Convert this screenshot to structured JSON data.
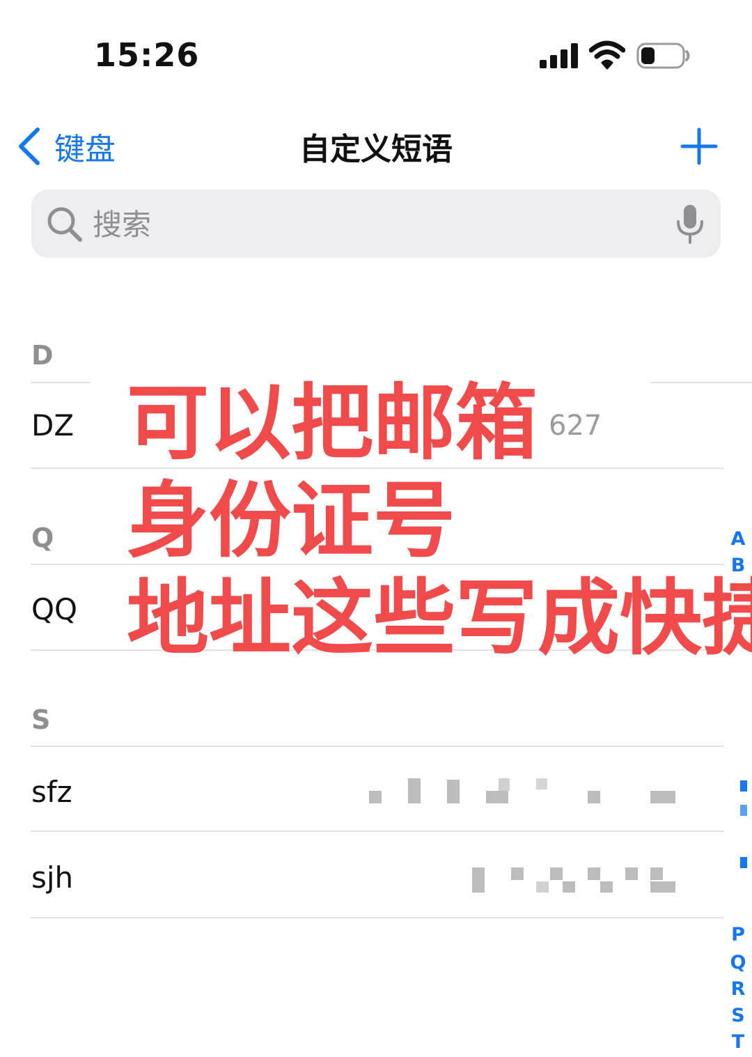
{
  "status_bar": {
    "time": "15:26"
  },
  "nav": {
    "back_label": "键盘",
    "title": "自定义短语"
  },
  "search": {
    "placeholder": "搜索"
  },
  "sections": [
    {
      "letter": "D",
      "rows": [
        {
          "shortcut": "DZ",
          "phrase": "627"
        }
      ]
    },
    {
      "letter": "Q",
      "rows": [
        {
          "shortcut": "QQ"
        }
      ]
    },
    {
      "letter": "S",
      "rows": [
        {
          "shortcut": "sfz"
        },
        {
          "shortcut": "sjh"
        }
      ]
    }
  ],
  "overlay_caption": {
    "line1": "可以把邮箱",
    "line2": "身份证号",
    "line3": "地址这些写成快捷"
  },
  "index_letters": [
    "A",
    "B",
    "P",
    "Q",
    "R",
    "S",
    "T"
  ],
  "colors": {
    "accent": "#1577f0",
    "caption": "#f04a4a",
    "section_header": "#8e8e93",
    "search_bg": "#eeeef0"
  }
}
